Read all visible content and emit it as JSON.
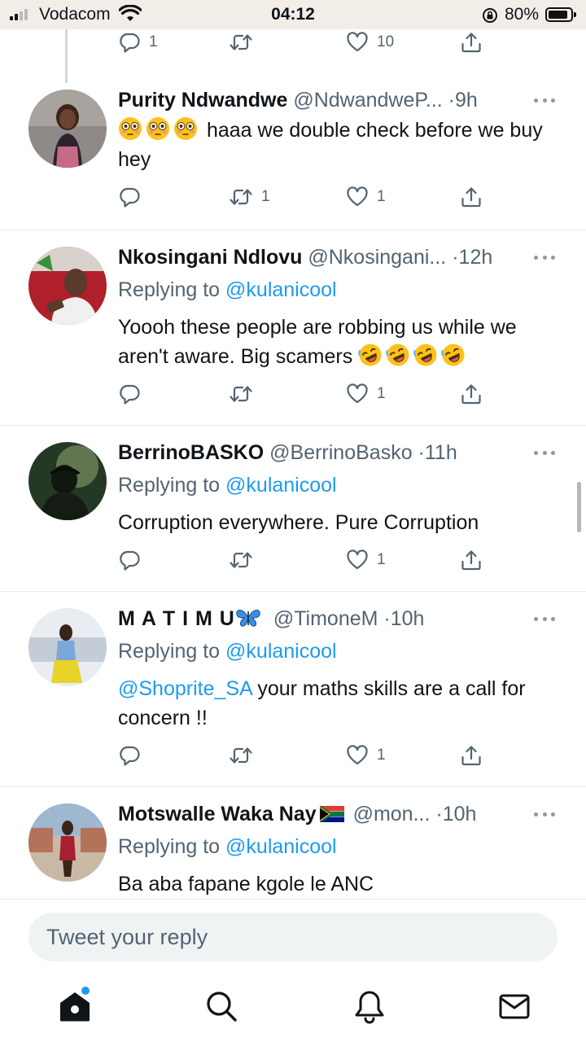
{
  "status_bar": {
    "carrier": "Vodacom",
    "time": "04:12",
    "battery": "80%"
  },
  "top_actions": {
    "reply_count": "1",
    "retweet_count": "",
    "like_count": "10"
  },
  "tweets": [
    {
      "name": "Purity Ndwandwe",
      "handle": "@NdwandweP...",
      "time": "9h",
      "replying_prefix": "",
      "replying_to": "",
      "text": "haaa we double check before we buy hey",
      "reply_count": "",
      "retweet_count": "1",
      "like_count": "1"
    },
    {
      "name": "Nkosingani Ndlovu",
      "handle": "@Nkosingani...",
      "time": "12h",
      "replying_prefix": "Replying to",
      "replying_to": "@kulanicool",
      "text": "Yoooh these people are robbing us while we aren't aware. Big scamers",
      "reply_count": "",
      "retweet_count": "",
      "like_count": "1"
    },
    {
      "name": "BerrinoBASKO",
      "handle": "@BerrinoBasko",
      "time": "11h",
      "replying_prefix": "Replying to",
      "replying_to": "@kulanicool",
      "text": "Corruption everywhere. Pure Corruption",
      "reply_count": "",
      "retweet_count": "",
      "like_count": "1"
    },
    {
      "name": "M A T I M U",
      "handle": "@TimoneM",
      "time": "10h",
      "replying_prefix": "Replying to",
      "replying_to": "@kulanicool",
      "text_mention": "@Shoprite_SA",
      "text": "your maths skills are a call for concern !!",
      "reply_count": "",
      "retweet_count": "",
      "like_count": "1"
    },
    {
      "name": "Motswalle Waka Nay",
      "handle": "@mon...",
      "time": "10h",
      "replying_prefix": "Replying to",
      "replying_to": "@kulanicool",
      "text": "Ba aba fapane kgole le ANC"
    }
  ],
  "separator": "·",
  "reply_bar": {
    "placeholder": "Tweet your reply"
  },
  "bottom_nav": {
    "items": [
      "home-icon",
      "search-icon",
      "bell-icon",
      "mail-icon"
    ]
  },
  "colors": {
    "accent": "#1d9bf0",
    "secondary_text": "#536471",
    "status_bar_bg": "#f3ede8"
  }
}
